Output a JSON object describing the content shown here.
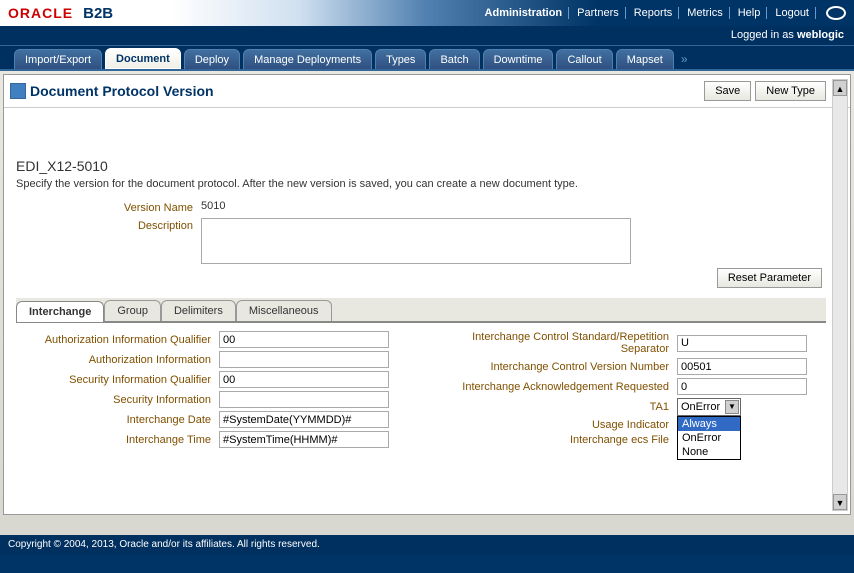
{
  "logo": {
    "brand": "ORACLE",
    "product": "B2B"
  },
  "header_links": {
    "admin": "Administration",
    "partners": "Partners",
    "reports": "Reports",
    "metrics": "Metrics",
    "help": "Help",
    "logout": "Logout"
  },
  "login_status": {
    "prefix": "Logged in as ",
    "user": "weblogic"
  },
  "main_tabs": {
    "import_export": "Import/Export",
    "document": "Document",
    "deploy": "Deploy",
    "manage_deployments": "Manage Deployments",
    "types": "Types",
    "batch": "Batch",
    "downtime": "Downtime",
    "callout": "Callout",
    "mapset": "Mapset"
  },
  "page": {
    "title": "Document Protocol Version",
    "save": "Save",
    "new_type": "New Type",
    "section_title": "EDI_X12-5010",
    "section_desc": "Specify the version for the document protocol. After the new version is saved, you can create a new document type.",
    "version_name_label": "Version Name",
    "version_name_value": "5010",
    "description_label": "Description",
    "description_value": "",
    "reset": "Reset Parameter"
  },
  "subtabs": {
    "interchange": "Interchange",
    "group": "Group",
    "delimiters": "Delimiters",
    "misc": "Miscellaneous"
  },
  "fields_left": {
    "auth_info_qual": {
      "label": "Authorization Information Qualifier",
      "value": "00"
    },
    "auth_info": {
      "label": "Authorization Information",
      "value": ""
    },
    "sec_info_qual": {
      "label": "Security Information Qualifier",
      "value": "00"
    },
    "sec_info": {
      "label": "Security Information",
      "value": ""
    },
    "inter_date": {
      "label": "Interchange Date",
      "value": "#SystemDate(YYMMDD)#"
    },
    "inter_time": {
      "label": "Interchange Time",
      "value": "#SystemTime(HHMM)#"
    }
  },
  "fields_right": {
    "ctrl_std": {
      "label": "Interchange Control Standard/Repetition Separator",
      "value": "U"
    },
    "ctrl_ver": {
      "label": "Interchange Control Version Number",
      "value": "00501",
      "required": true
    },
    "ack_req": {
      "label": "Interchange Acknowledgement Requested",
      "value": "0",
      "required": true
    },
    "ta1": {
      "label": "TA1",
      "value": "OnError",
      "options": [
        "Always",
        "OnError",
        "None"
      ]
    },
    "usage": {
      "label": "Usage Indicator",
      "value": ""
    },
    "ecs": {
      "label": "Interchange ecs File",
      "value": ""
    }
  },
  "footer": "Copyright © 2004, 2013, Oracle and/or its affiliates.  All rights reserved."
}
